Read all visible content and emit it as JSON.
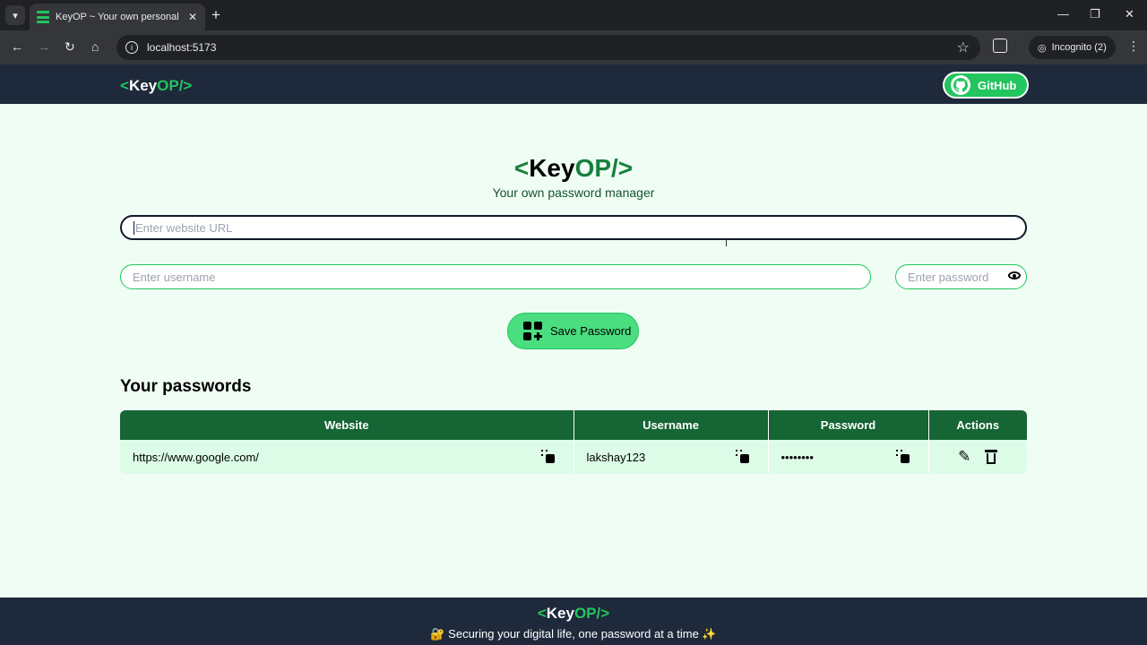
{
  "browser": {
    "tab_title": "KeyOP ~ Your own personal pa",
    "tab_close": "✕",
    "new_tab": "+",
    "url": "localhost:5173",
    "incognito_label": "Incognito (2)",
    "nav_icons": [
      "back-icon",
      "forward-icon",
      "reload-icon",
      "home-icon"
    ]
  },
  "navbar": {
    "logo": {
      "open": "<",
      "key": "Key",
      "op": "OP",
      "close": "/>"
    },
    "github_label": "GitHub"
  },
  "hero": {
    "logo": {
      "open": "<",
      "key": "Key",
      "op": "OP",
      "close": "/>"
    },
    "subtitle": "Your own password manager"
  },
  "form": {
    "website_placeholder": "Enter website URL",
    "username_placeholder": "Enter username",
    "password_placeholder": "Enter password",
    "save_label": "Save Password"
  },
  "passwords": {
    "title": "Your passwords",
    "headers": [
      "Website",
      "Username",
      "Password",
      "Actions"
    ],
    "rows": [
      {
        "website": "https://www.google.com/",
        "username": "lakshay123",
        "password": "••••••••"
      }
    ]
  },
  "footer": {
    "logo": {
      "open": "<",
      "key": "Key",
      "op": "OP",
      "close": "/>"
    },
    "tagline": "🔐 Securing your digital life, one password at a time ✨"
  },
  "colors": {
    "accent": "#22c55e",
    "dark_header": "#1e293b",
    "table_header": "#166534",
    "row_bg": "#dcfce7",
    "page_bg": "#f0fdf4"
  }
}
